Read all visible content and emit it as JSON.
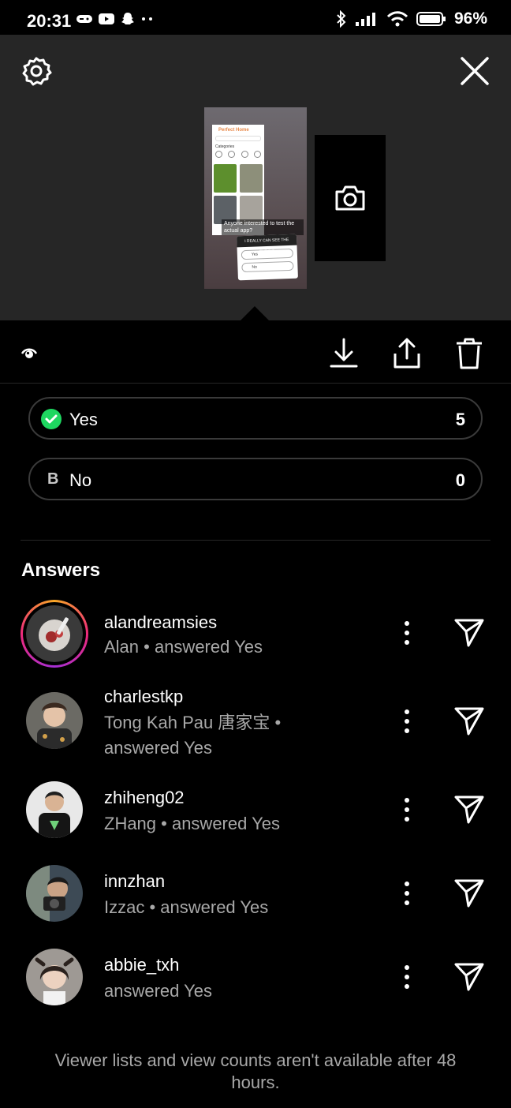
{
  "status_bar": {
    "time": "20:31",
    "battery": "96%"
  },
  "preview": {
    "caption": "Anyone interested to test the actual app?",
    "phone_title": "Perfect Home",
    "phone_category": "Categories",
    "poll_head": "I REALLY CAN SEE THE ENDING",
    "poll_opt_yes": "Yes",
    "poll_opt_no": "No"
  },
  "poll": {
    "options": [
      {
        "badge": "check",
        "label": "Yes",
        "count": "5"
      },
      {
        "letter": "B",
        "label": "No",
        "count": "0"
      }
    ]
  },
  "answers": {
    "title": "Answers",
    "items": [
      {
        "username": "alandreamsies",
        "subtitle": "Alan • answered Yes"
      },
      {
        "username": "charlestkp",
        "subtitle": "Tong Kah Pau 唐家宝 • answered Yes"
      },
      {
        "username": "zhiheng02",
        "subtitle": "ZHang • answered Yes"
      },
      {
        "username": "innzhan",
        "subtitle": "Izzac • answered Yes"
      },
      {
        "username": "abbie_txh",
        "subtitle": "answered Yes"
      }
    ]
  },
  "footer": {
    "note": "Viewer lists and view counts aren't available after 48 hours."
  },
  "colors": {
    "accent_green": "#1ed760",
    "ring_start": "#f9a826",
    "ring_end": "#a52fd5"
  }
}
